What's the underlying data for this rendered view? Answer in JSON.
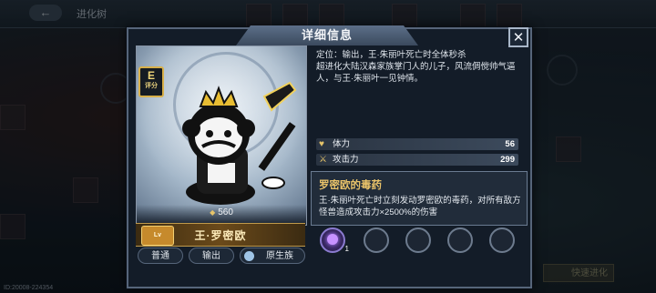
{
  "background": {
    "back_icon": "arrow-left-icon",
    "title": "进化树",
    "id_text": "ID:20008-224354",
    "right_button": "快速进化"
  },
  "dialog": {
    "title": "详细信息",
    "close_icon": "close-icon"
  },
  "character": {
    "rating_value": "E",
    "rating_label": "评分",
    "power": "560",
    "rank_badge": "Lv",
    "name": "王·罗密欧",
    "tags": [
      "普通",
      "输出",
      "原生族"
    ]
  },
  "description": {
    "line1": "定位：输出，王·朱丽叶死亡时全体秒杀",
    "line2": "超进化大陆汉森家族掌门人的儿子，风流倜傥帅气逼人，与王·朱丽叶一见钟情。"
  },
  "stats": [
    {
      "icon": "heart-icon",
      "name": "体力",
      "value": "56"
    },
    {
      "icon": "sword-icon",
      "name": "攻击力",
      "value": "299"
    }
  ],
  "skill": {
    "name": "罗密欧的毒药",
    "description": "王·朱丽叶死亡时立刻发动罗密欧的毒药，对所有敌方怪兽造成攻击力×2500%的伤害"
  },
  "equipment": {
    "slot1_level": "1"
  }
}
